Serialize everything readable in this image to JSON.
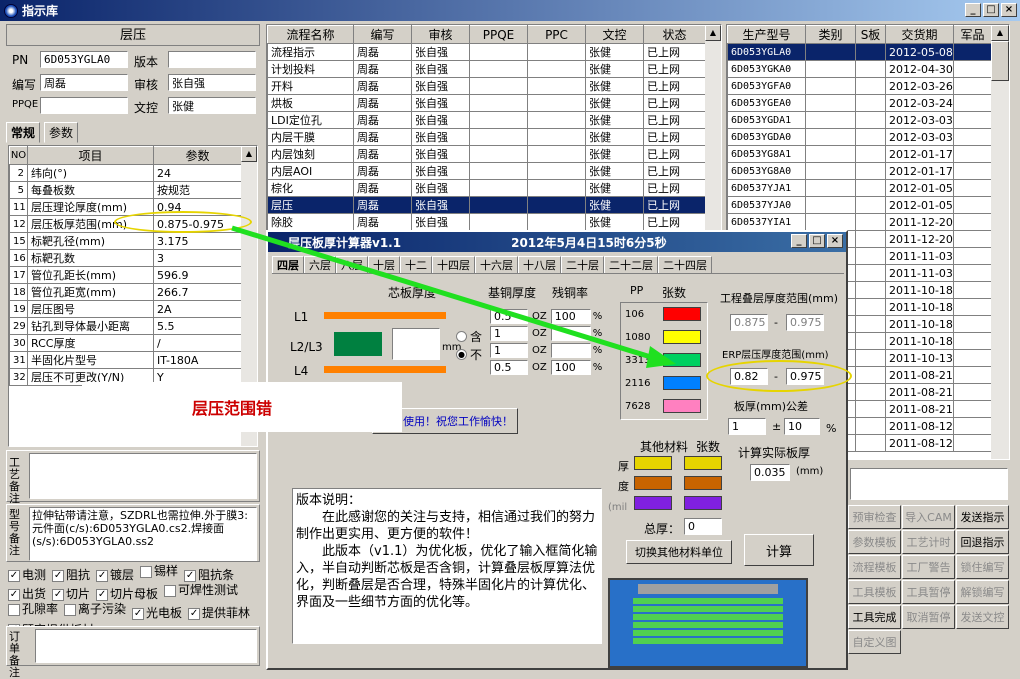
{
  "window": {
    "title": "指示库",
    "min": "_",
    "max": "□",
    "close": "×"
  },
  "left": {
    "header": "层压",
    "pn_label": "PN",
    "pn_value": "6D053YGLA0",
    "version_label": "版本",
    "version_value": "",
    "editor_label": "编写",
    "editor_value": "周磊",
    "review_label": "审核",
    "review_value": "张自强",
    "ppqe_label": "PPQE",
    "ppqe_value": "",
    "doc_label": "文控",
    "doc_value": "张健",
    "tabs": [
      "常规",
      "参数"
    ],
    "table_headers": [
      "NO",
      "项目",
      "参数"
    ],
    "rows": [
      [
        "2",
        "纬向(°)",
        "24"
      ],
      [
        "5",
        "每叠板数",
        "按规范"
      ],
      [
        "11",
        "层压理论厚度(mm)",
        "0.94"
      ],
      [
        "12",
        "层压板厚范围(mm)",
        "0.875-0.975"
      ],
      [
        "15",
        "标靶孔径(mm)",
        "3.175"
      ],
      [
        "16",
        "标靶孔数",
        "3"
      ],
      [
        "17",
        "管位孔距长(mm)",
        "596.9"
      ],
      [
        "18",
        "管位孔距宽(mm)",
        "266.7"
      ],
      [
        "19",
        "层压图号",
        "2A"
      ],
      [
        "29",
        "钻孔到导体最小距离",
        "5.5"
      ],
      [
        "30",
        "RCC厚度",
        "/"
      ],
      [
        "31",
        "半固化片型号",
        "IT-180A"
      ],
      [
        "32",
        "层压不可更改(Y/N)",
        "Y"
      ]
    ],
    "process_note_label": "工艺备注",
    "model_note_label": "型号备注",
    "model_note": "拉伸钻带请注意，SZDRL也需拉伸.外于膜3:元件面(c/s):6D053YGLA0.cs2.焊接面(s/s):6D053YGLA0.ss2",
    "checks": [
      [
        "电测",
        true
      ],
      [
        "阻抗",
        true
      ],
      [
        "镀层",
        true
      ],
      [
        "锡样",
        false
      ],
      [
        "阻抗条",
        true
      ],
      [
        "出货",
        true
      ],
      [
        "切片",
        true
      ],
      [
        "切片母板",
        true
      ],
      [
        "可焊性测试",
        false
      ],
      [
        "孔隙率",
        false
      ],
      [
        "离子污染",
        false
      ],
      [
        "光电板",
        true
      ],
      [
        "提供菲林",
        true
      ],
      [
        "顾客提供板材",
        true
      ]
    ],
    "order_note_label": "订单备注"
  },
  "flow": {
    "headers": [
      "流程名称",
      "编写",
      "审核",
      "PPQE",
      "PPC",
      "文控",
      "状态"
    ],
    "rows": [
      [
        "流程指示",
        "周磊",
        "张自强",
        "",
        "",
        "张健",
        "已上网"
      ],
      [
        "计划投料",
        "周磊",
        "张自强",
        "",
        "",
        "张健",
        "已上网"
      ],
      [
        "开料",
        "周磊",
        "张自强",
        "",
        "",
        "张健",
        "已上网"
      ],
      [
        "烘板",
        "周磊",
        "张自强",
        "",
        "",
        "张健",
        "已上网"
      ],
      [
        "LDI定位孔",
        "周磊",
        "张自强",
        "",
        "",
        "张健",
        "已上网"
      ],
      [
        "内层干膜",
        "周磊",
        "张自强",
        "",
        "",
        "张健",
        "已上网"
      ],
      [
        "内层蚀刻",
        "周磊",
        "张自强",
        "",
        "",
        "张健",
        "已上网"
      ],
      [
        "内层AOI",
        "周磊",
        "张自强",
        "",
        "",
        "张健",
        "已上网"
      ],
      [
        "棕化",
        "周磊",
        "张自强",
        "",
        "",
        "张健",
        "已上网"
      ],
      [
        "层压",
        "周磊",
        "张自强",
        "",
        "",
        "张健",
        "已上网"
      ],
      [
        "除胶",
        "周磊",
        "张自强",
        "",
        "",
        "张健",
        "已上网"
      ]
    ],
    "selected": 9
  },
  "models": {
    "headers": [
      "生产型号",
      "类别",
      "S板",
      "交货期",
      "军品"
    ],
    "rows": [
      [
        "6D053YGLA0",
        "2012-05-08"
      ],
      [
        "6D053YGKA0",
        "2012-04-30"
      ],
      [
        "6D053YGFA0",
        "2012-03-26"
      ],
      [
        "6D053YGEA0",
        "2012-03-24"
      ],
      [
        "6D053YGDA1",
        "2012-03-03"
      ],
      [
        "6D053YGDA0",
        "2012-03-03"
      ],
      [
        "6D053YG8A1",
        "2012-01-17"
      ],
      [
        "6D053YG8A0",
        "2012-01-17"
      ],
      [
        "6D0537YJA1",
        "2012-01-05"
      ],
      [
        "6D0537YJA0",
        "2012-01-05"
      ],
      [
        "6D0537YIA1",
        "2011-12-20"
      ],
      [
        "",
        "2011-12-20"
      ],
      [
        "",
        "2011-11-03"
      ],
      [
        "",
        "2011-11-03"
      ],
      [
        "",
        "2011-10-18"
      ],
      [
        "",
        "2011-10-18"
      ],
      [
        "",
        "2011-10-18"
      ],
      [
        "",
        "2011-10-18"
      ],
      [
        "",
        "2011-10-13"
      ],
      [
        "",
        "2011-08-21"
      ],
      [
        "",
        "2011-08-21"
      ],
      [
        "",
        "2011-08-21"
      ],
      [
        "",
        "2011-08-12"
      ],
      [
        "",
        "2011-08-12"
      ]
    ]
  },
  "buttons": [
    [
      "预审检查",
      false
    ],
    [
      "导入CAM",
      false
    ],
    [
      "发送指示",
      true
    ],
    [
      "参数模板",
      false
    ],
    [
      "工艺计时",
      false
    ],
    [
      "回退指示",
      true
    ],
    [
      "流程模板",
      false
    ],
    [
      "工厂警告",
      false
    ],
    [
      "锁住编写",
      false
    ],
    [
      "工具模板",
      false
    ],
    [
      "工具暂停",
      false
    ],
    [
      "解锁编写",
      false
    ],
    [
      "工具完成",
      true
    ],
    [
      "取消暂停",
      false
    ],
    [
      "发送文控",
      false
    ],
    [
      "自定义图",
      false
    ]
  ],
  "calc": {
    "title": "层压板厚计算器v1.1",
    "datetime": "2012年5月4日15时6分5秒",
    "tabs": [
      "四层",
      "六层",
      "八层",
      "十层",
      "十二",
      "十四层",
      "十六层",
      "十八层",
      "二十层",
      "二十二层",
      "二十四层"
    ],
    "core_label": "芯板厚度",
    "cu_label": "基铜厚度",
    "residual_label": "残铜率",
    "pp_label": "PP",
    "count_label": "张数",
    "l1": "L1",
    "l23": "L2/L3",
    "l4": "L4",
    "mm": "mm",
    "inc": "含",
    "exc": "不",
    "cu_rows": [
      [
        "0.5",
        "100"
      ],
      [
        "1",
        ""
      ],
      [
        "1",
        ""
      ],
      [
        "0.5",
        "100"
      ]
    ],
    "oz": "OZ",
    "pct": "%",
    "pp_types": [
      "106",
      "1080",
      "3313",
      "2116",
      "7628"
    ],
    "pp_colors": [
      "#ff0000",
      "#ffff00",
      "#00d060",
      "#0080ff",
      "#ff80c0"
    ],
    "eng_range_label": "工程叠层厚度范围(mm)",
    "eng_min": "0.875",
    "eng_max": "0.975",
    "erp_range_label": "ERP层压厚度范围(mm)",
    "erp_min": "0.82",
    "erp_max": "0.975",
    "tol_label": "板厚(mm)公差",
    "tol_thick": "1",
    "tol_pm": "±",
    "tol_val": "10",
    "tol_pct": "%",
    "actual_label": "计算实际板厚",
    "actual_val": "0.035",
    "actual_unit": "(mm)",
    "other_label": "其他材料",
    "other_count": "张数",
    "thick_l1": "厚",
    "thick_l2": "度",
    "mil": "(mil",
    "total_label": "总厚：",
    "total_val": "0",
    "switch_btn": "切换其他材料单位",
    "calc_btn": "计算",
    "greeting": "使用！祝您工作愉快！",
    "notes": "版本说明：\n　　在此感谢您的关注与支持，相信通过我们的努力制作出更实用、更方便的软件！\n　　此版本（v1.1）为优化板，优化了输入框简化输入，半自动判断芯板是否含铜，计算叠层板厚算法优化，判断叠层是否合理，特殊半固化片的计算优化、界面及一些细节方面的优化等。"
  },
  "annotation": {
    "text": "层压范围错",
    "color": "#cc0000"
  }
}
